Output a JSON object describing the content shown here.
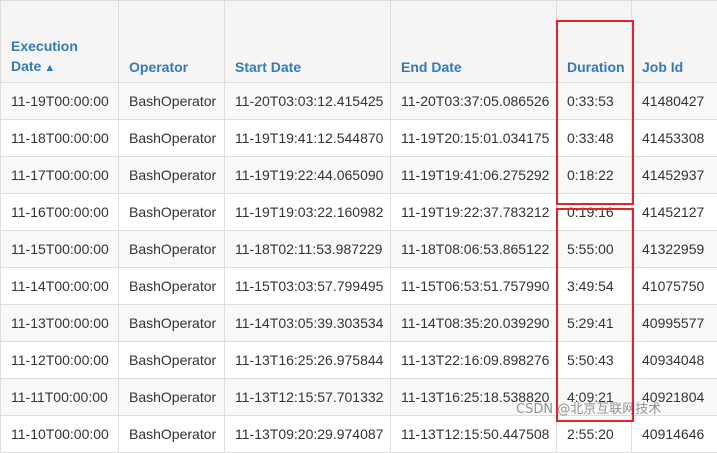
{
  "table": {
    "headers": {
      "execution_date_line1": "Execution",
      "execution_date_line2": "Date",
      "sort_icon": "chevron-up-icon",
      "operator": "Operator",
      "start_date": "Start Date",
      "end_date": "End Date",
      "duration": "Duration",
      "job_id": "Job Id"
    },
    "rows": [
      {
        "execution_date": "11-19T00:00:00",
        "operator": "BashOperator",
        "start_date": "11-20T03:03:12.415425",
        "end_date": "11-20T03:37:05.086526",
        "duration": "0:33:53",
        "job_id": "41480427"
      },
      {
        "execution_date": "11-18T00:00:00",
        "operator": "BashOperator",
        "start_date": "11-19T19:41:12.544870",
        "end_date": "11-19T20:15:01.034175",
        "duration": "0:33:48",
        "job_id": "41453308"
      },
      {
        "execution_date": "11-17T00:00:00",
        "operator": "BashOperator",
        "start_date": "11-19T19:22:44.065090",
        "end_date": "11-19T19:41:06.275292",
        "duration": "0:18:22",
        "job_id": "41452937"
      },
      {
        "execution_date": "11-16T00:00:00",
        "operator": "BashOperator",
        "start_date": "11-19T19:03:22.160982",
        "end_date": "11-19T19:22:37.783212",
        "duration": "0:19:16",
        "job_id": "41452127"
      },
      {
        "execution_date": "11-15T00:00:00",
        "operator": "BashOperator",
        "start_date": "11-18T02:11:53.987229",
        "end_date": "11-18T08:06:53.865122",
        "duration": "5:55:00",
        "job_id": "41322959"
      },
      {
        "execution_date": "11-14T00:00:00",
        "operator": "BashOperator",
        "start_date": "11-15T03:03:57.799495",
        "end_date": "11-15T06:53:51.757990",
        "duration": "3:49:54",
        "job_id": "41075750"
      },
      {
        "execution_date": "11-13T00:00:00",
        "operator": "BashOperator",
        "start_date": "11-14T03:05:39.303534",
        "end_date": "11-14T08:35:20.039290",
        "duration": "5:29:41",
        "job_id": "40995577"
      },
      {
        "execution_date": "11-12T00:00:00",
        "operator": "BashOperator",
        "start_date": "11-13T16:25:26.975844",
        "end_date": "11-13T22:16:09.898276",
        "duration": "5:50:43",
        "job_id": "40934048"
      },
      {
        "execution_date": "11-11T00:00:00",
        "operator": "BashOperator",
        "start_date": "11-13T12:15:57.701332",
        "end_date": "11-13T16:25:18.538820",
        "duration": "4:09:21",
        "job_id": "40921804"
      },
      {
        "execution_date": "11-10T00:00:00",
        "operator": "BashOperator",
        "start_date": "11-13T09:20:29.974087",
        "end_date": "11-13T12:15:50.447508",
        "duration": "2:55:20",
        "job_id": "40914646"
      }
    ]
  },
  "highlight_color": "#e1242b",
  "watermark": "CSDN @北京互联网技术"
}
